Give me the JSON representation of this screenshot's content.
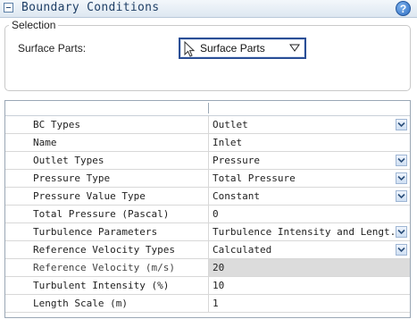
{
  "header": {
    "title": "Boundary Conditions"
  },
  "selection": {
    "legend": "Selection",
    "surface_label": "Surface Parts:",
    "surface_value": "Surface Parts"
  },
  "table": {
    "rows": [
      {
        "name": "BC Types",
        "value": "Outlet",
        "dropdown": true,
        "greyed": false
      },
      {
        "name": "Name",
        "value": "Inlet",
        "dropdown": false,
        "greyed": false
      },
      {
        "name": "Outlet Types",
        "value": "Pressure",
        "dropdown": true,
        "greyed": false
      },
      {
        "name": "Pressure Type",
        "value": "Total Pressure",
        "dropdown": true,
        "greyed": false
      },
      {
        "name": "Pressure Value Type",
        "value": "Constant",
        "dropdown": true,
        "greyed": false
      },
      {
        "name": "Total Pressure (Pascal)",
        "value": "0",
        "dropdown": false,
        "greyed": false
      },
      {
        "name": "Turbulence Parameters",
        "value": "Turbulence Intensity and Lengt...",
        "dropdown": true,
        "greyed": false
      },
      {
        "name": "Reference Velocity Types",
        "value": "Calculated",
        "dropdown": true,
        "greyed": false
      },
      {
        "name": "Reference Velocity (m/s)",
        "value": "20",
        "dropdown": false,
        "greyed": true
      },
      {
        "name": "Turbulent Intensity (%)",
        "value": "10",
        "dropdown": false,
        "greyed": false
      },
      {
        "name": "Length Scale (m)",
        "value": "1",
        "dropdown": false,
        "greyed": false
      }
    ]
  }
}
